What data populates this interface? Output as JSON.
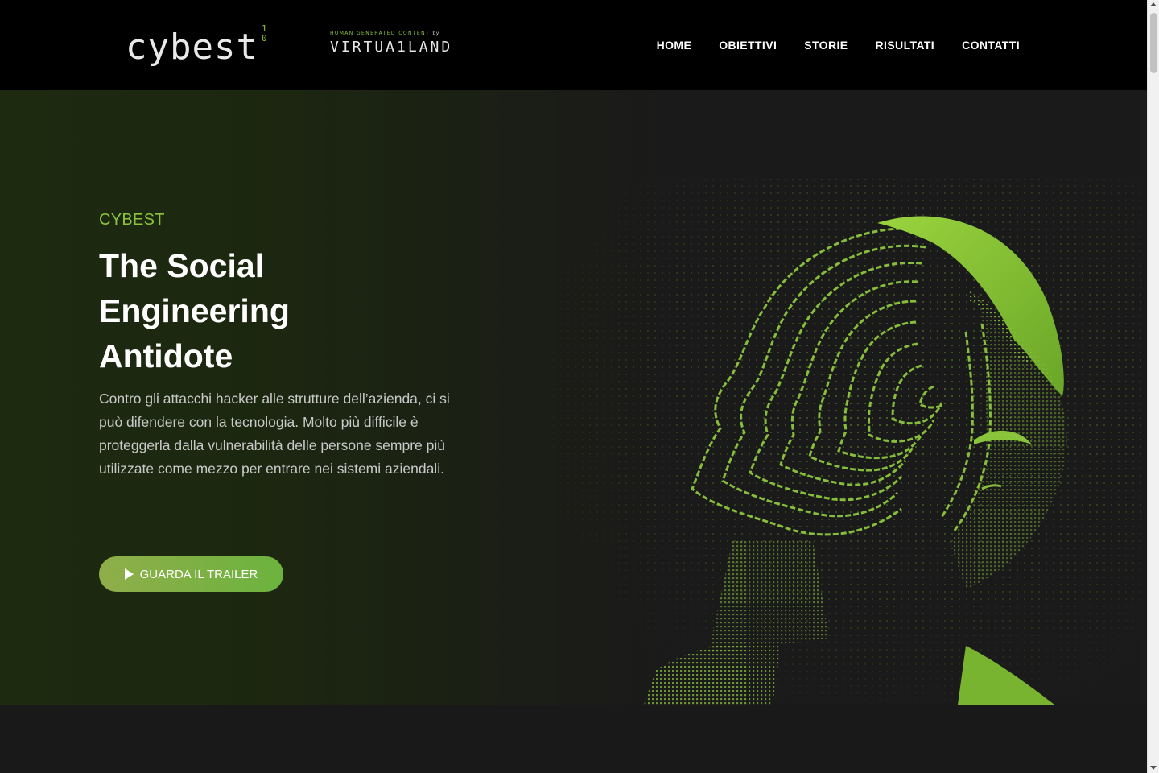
{
  "brand": {
    "logo_text": "cybest",
    "logo_bits": [
      "1",
      "0"
    ],
    "partner_tag": "HUMAN GENERATED CONTENT",
    "partner_by": "by",
    "partner_name": "VIRTUA1LAND"
  },
  "nav": {
    "items": [
      {
        "label": "HOME"
      },
      {
        "label": "OBIETTIVI"
      },
      {
        "label": "STORIE"
      },
      {
        "label": "RISULTATI"
      },
      {
        "label": "CONTATTI"
      }
    ]
  },
  "hero": {
    "eyebrow": "CYBEST",
    "title_lines": [
      "The Social",
      "Engineering",
      "Antidote"
    ],
    "description": "Contro gli attacchi hacker alle strutture dell’azienda, ci si può difendere con la tecnologia. Molto più difficile è proteggerla dalla vulnerabilità delle persone sempre più utilizzate come mezzo per entrare nei sistemi aziendali.",
    "cta_label": "GUARDA IL TRAILER",
    "cta_icon": "play-icon",
    "art_icon": "digital-head-illustration"
  },
  "colors": {
    "accent": "#8cc43c",
    "header_bg": "#000000",
    "hero_bg": "#1a1a1a",
    "cta_gradient_start": "#8fae4a",
    "cta_gradient_end": "#6cb33e",
    "text": "#ffffff",
    "muted_text": "#c9c9c9"
  }
}
